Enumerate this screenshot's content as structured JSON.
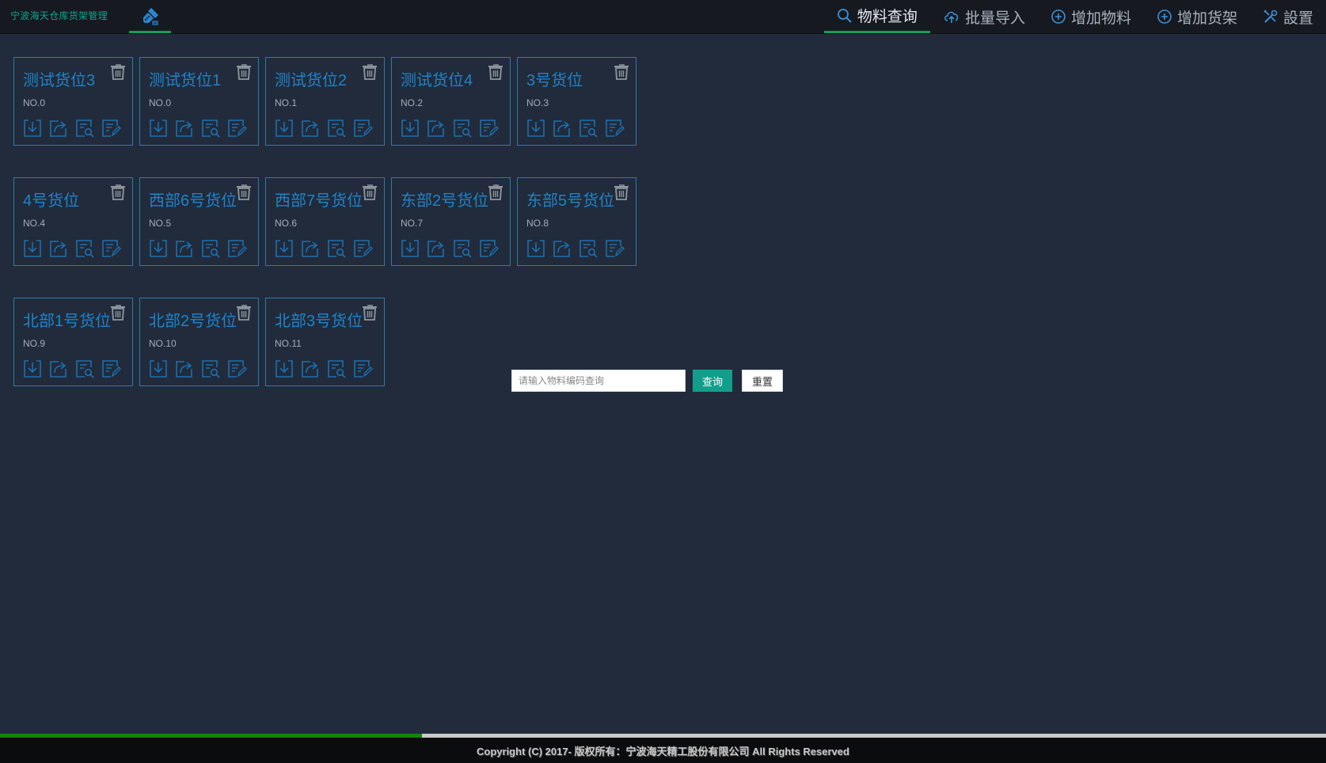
{
  "app": {
    "brand": "宁波海天仓库货架管理"
  },
  "nav": [
    {
      "key": "query",
      "label": "物料查询",
      "icon": "search-icon",
      "active": true
    },
    {
      "key": "import",
      "label": "批量导入",
      "icon": "cloud-upload-icon",
      "active": false
    },
    {
      "key": "add-material",
      "label": "增加物料",
      "icon": "plus-circle-icon",
      "active": false
    },
    {
      "key": "add-shelf",
      "label": "增加货架",
      "icon": "plus-circle-icon",
      "active": false
    },
    {
      "key": "settings",
      "label": "設置",
      "icon": "tools-icon",
      "active": false
    }
  ],
  "cards": [
    {
      "title": "测试货位3",
      "no": "NO.0"
    },
    {
      "title": "测试货位1",
      "no": "NO.0"
    },
    {
      "title": "测试货位2",
      "no": "NO.1"
    },
    {
      "title": "测试货位4",
      "no": "NO.2"
    },
    {
      "title": "3号货位",
      "no": "NO.3"
    },
    {
      "title": "4号货位",
      "no": "NO.4"
    },
    {
      "title": "西部6号货位",
      "no": "NO.5"
    },
    {
      "title": "西部7号货位",
      "no": "NO.6"
    },
    {
      "title": "东部2号货位",
      "no": "NO.7"
    },
    {
      "title": "东部5号货位",
      "no": "NO.8"
    },
    {
      "title": "北部1号货位",
      "no": "NO.9"
    },
    {
      "title": "北部2号货位",
      "no": "NO.10"
    },
    {
      "title": "北部3号货位",
      "no": "NO.11"
    }
  ],
  "card_actions": [
    "stock-in-icon",
    "stock-out-icon",
    "view-detail-icon",
    "edit-icon"
  ],
  "search": {
    "placeholder": "请输入物料编码查询",
    "query_label": "查询",
    "reset_label": "重置"
  },
  "progress": {
    "fraction": 0.318
  },
  "footer": {
    "text": "Copyright (C) 2017- 版权所有：宁波海天精工股份有限公司 All Rights Reserved"
  },
  "colors": {
    "background": "#212b3b",
    "topbar": "#161a20",
    "accent_green": "#14a05a",
    "card_border": "#2b7ca5",
    "card_title": "#1f83c9",
    "icon_blue": "#1c6fb0",
    "brand_teal": "#12a58f",
    "query_button": "#119f8b"
  }
}
